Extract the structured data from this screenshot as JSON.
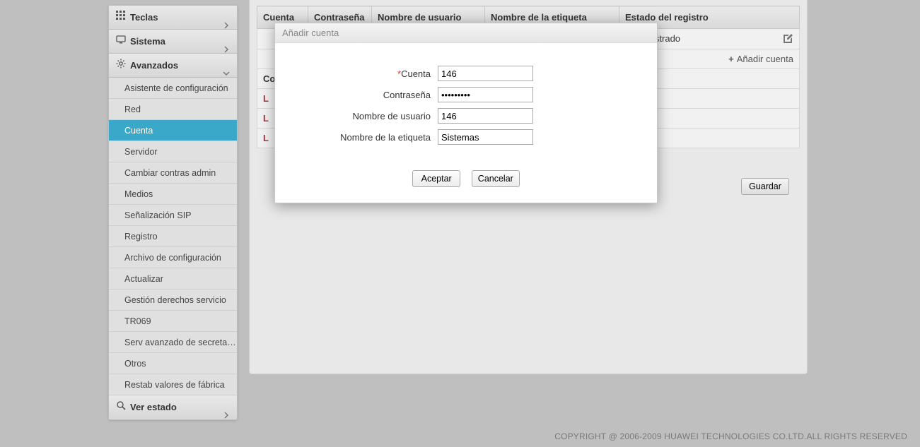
{
  "sidebar": {
    "teclas": {
      "label": "Teclas"
    },
    "sistema": {
      "label": "Sistema"
    },
    "avanzados": {
      "label": "Avanzados",
      "items": [
        {
          "label": "Asistente de configuración"
        },
        {
          "label": "Red"
        },
        {
          "label": "Cuenta"
        },
        {
          "label": "Servidor"
        },
        {
          "label": "Cambiar contras admin"
        },
        {
          "label": "Medios"
        },
        {
          "label": "Señalización SIP"
        },
        {
          "label": "Registro"
        },
        {
          "label": "Archivo de configuración"
        },
        {
          "label": "Actualizar"
        },
        {
          "label": "Gestión derechos servicio"
        },
        {
          "label": "TR069"
        },
        {
          "label": "Serv avanzado de secretaria"
        },
        {
          "label": "Otros"
        },
        {
          "label": "Restab valores de fábrica"
        }
      ]
    },
    "verestado": {
      "label": "Ver estado"
    }
  },
  "table": {
    "headers": {
      "cuenta": "Cuenta",
      "contrasena": "Contraseña",
      "usuario": "Nombre de usuario",
      "etiqueta": "Nombre de la etiqueta",
      "estado": "Estado del registro"
    },
    "row1": {
      "estado": "No registrado"
    },
    "add_label": "Añadir cuenta",
    "section_label": "Co",
    "lines": {
      "l1": "L",
      "l2": "L",
      "l3": "L"
    }
  },
  "save_button": "Guardar",
  "dialog": {
    "title": "Añadir cuenta",
    "fields": {
      "cuenta": {
        "label": "Cuenta",
        "value": "146"
      },
      "contrasena": {
        "label": "Contraseña",
        "value": "•••••••••"
      },
      "usuario": {
        "label": "Nombre de usuario",
        "value": "146"
      },
      "etiqueta": {
        "label": "Nombre de la etiqueta",
        "value": "Sistemas"
      }
    },
    "actions": {
      "accept": "Aceptar",
      "cancel": "Cancelar"
    }
  },
  "footer": "COPYRIGHT @ 2006-2009 HUAWEI TECHNOLOGIES CO.LTD.ALL RIGHTS RESERVED"
}
